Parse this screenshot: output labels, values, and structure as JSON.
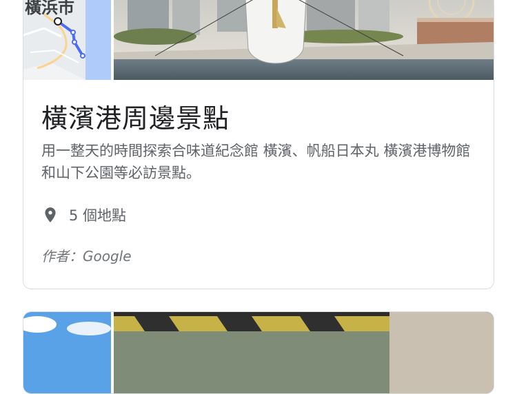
{
  "card": {
    "map_label": "橫浜市",
    "title": "橫濱港周邊景點",
    "description": "用一整天的時間探索合味道紀念館 橫濱、帆船日本丸 橫濱港博物館和山下公園等必訪景點。",
    "place_count": "5 個地點",
    "author": "作者：Google",
    "icons": {
      "place": "location-pin-icon"
    }
  },
  "colors": {
    "title": "#202124",
    "secondary_text": "#5f6368",
    "card_border": "#dadce0",
    "route": "#4a6cf7"
  }
}
